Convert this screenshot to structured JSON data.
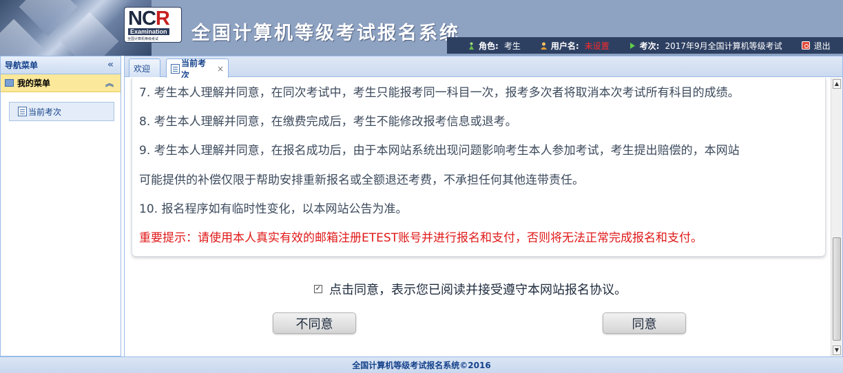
{
  "header": {
    "logo_text": "NCR",
    "logo_sub": "Examination",
    "logo_tiny": "全国计算机等级考试",
    "title": "全国计算机等级考试报名系统"
  },
  "userbar": {
    "role_label": "角色:",
    "role_value": "考生",
    "username_label": "用户名:",
    "username_value": "未设置",
    "exam_label": "考次:",
    "exam_value": "2017年9月全国计算机等级考试",
    "logout_label": "退出"
  },
  "nav": {
    "title": "导航菜单",
    "group_label": "我的菜单",
    "items": [
      {
        "label": "当前考次"
      }
    ]
  },
  "tabs": [
    {
      "label": "欢迎"
    },
    {
      "label": "当前考次",
      "close": "×"
    }
  ],
  "agreement": {
    "lines": [
      "7. 考生本人理解并同意，在同次考试中，考生只能报考同一科目一次，报考多次者将取消本次考试所有科目的成绩。",
      "8. 考生本人理解并同意，在缴费完成后，考生不能修改报考信息或退考。",
      "9. 考生本人理解并同意，在报名成功后，由于本网站系统出现问题影响考生本人参加考试，考生提出赔偿的，本网站",
      "可能提供的补偿仅限于帮助安排重新报名或全额退还考费，不承担任何其他连带责任。",
      "10. 报名程序如有临时性变化，以本网站公告为准。"
    ],
    "warning": "重要提示：请使用本人真实有效的邮箱注册ETEST账号并进行报名和支付，否则将无法正常完成报名和支付。"
  },
  "confirm": {
    "checked": true,
    "text": "点击同意，表示您已阅读并接受遵守本网站报名协议。"
  },
  "buttons": {
    "disagree": "不同意",
    "agree": "同意"
  },
  "footer": {
    "text": "全国计算机等级考试报名系统©2016"
  },
  "colors": {
    "header_bg": "#8ea2c2",
    "userbar_bg": "#2e4062",
    "warning": "#e01818",
    "nav_group_bg": "#fbe89a"
  }
}
